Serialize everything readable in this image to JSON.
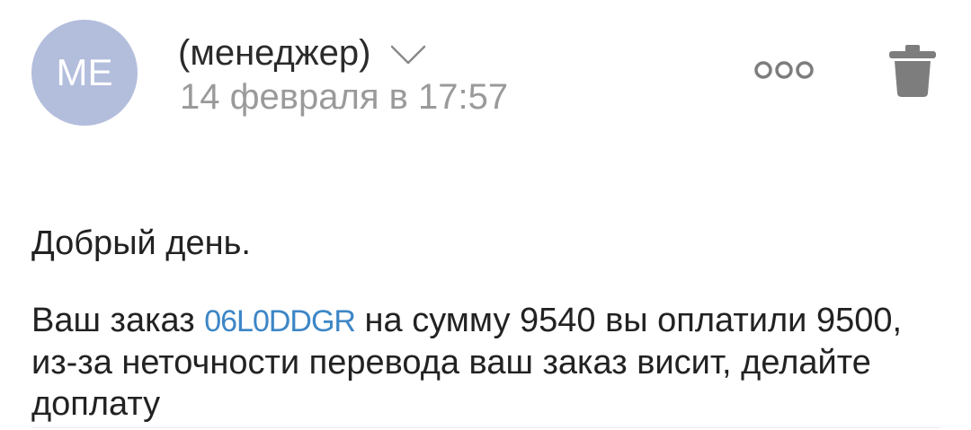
{
  "sender": {
    "avatar_initials": "ME",
    "avatar_color": "#b3bddc",
    "name": "(менеджер)",
    "expand_icon": "chevron-down-icon",
    "date": "14 февраля в 17:57"
  },
  "actions": {
    "more_icon": "more-dots-icon",
    "delete_icon": "trash-icon"
  },
  "message": {
    "greeting": "Добрый день.",
    "text_before_link": "Ваш заказ ",
    "order_link": "06L0DDGR",
    "text_after_link": " на сумму 9540 вы оплатили 9500, из-за неточности перевода ваш заказ висит, делайте доплату"
  },
  "colors": {
    "link": "#3d86c6",
    "date": "#9a9a9a",
    "icon": "#7d7d7d"
  }
}
